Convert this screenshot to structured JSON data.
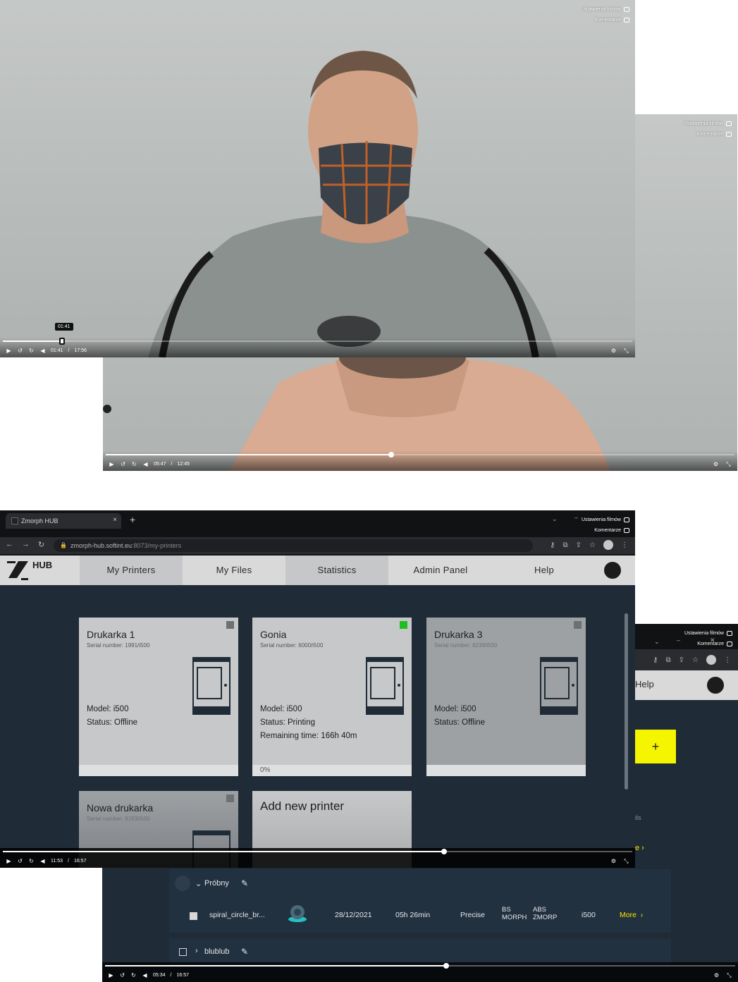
{
  "video1": {
    "overlay": {
      "settings": "Ustawienia filmów",
      "comments": "Komentarze"
    },
    "time_current": "01:41",
    "time_total": "17:56",
    "tooltip": "01:41",
    "progress_fraction": 0.094
  },
  "video2": {
    "overlay": {
      "settings": "Ustawienia filmów",
      "comments": "Komentarze"
    },
    "time_current": "05:47",
    "time_total": "12:45",
    "progress_fraction": 0.454
  },
  "video3": {
    "overlay": {
      "settings": "Ustawienia filmów",
      "comments": "Komentarze"
    },
    "time_current": "11:53",
    "time_total": "16:57",
    "progress_fraction": 0.701,
    "browser": {
      "tab_title": "Zmorph HUB",
      "url_host": "zmorph-hub.softint.eu",
      "url_path": ":8073/my-printers"
    },
    "nav": {
      "brand": "HUB",
      "tabs": [
        "My Printers",
        "My Files",
        "Statistics",
        "Admin Panel",
        "Help"
      ]
    },
    "printers": [
      {
        "name": "Drukarka 1",
        "serial": "Serial number: 1991/i500",
        "model_label": "Model:",
        "model": "i500",
        "status_label": "Status:",
        "status": "Offline",
        "online": false
      },
      {
        "name": "Gonia",
        "serial": "Serial number: 6000/i500",
        "model_label": "Model:",
        "model": "i500",
        "status_label": "Status:",
        "status": "Printing",
        "remaining_label": "Remaining time:",
        "remaining": "166h 40m",
        "progress": "0%",
        "online": true
      },
      {
        "name": "Drukarka 3",
        "serial": "Serial number: 8239/i500",
        "model_label": "Model:",
        "model": "i500",
        "status_label": "Status:",
        "status": "Offline",
        "online": false
      },
      {
        "name": "Nowa drukarka",
        "serial": "Serial number: 9193/i500",
        "online": false
      }
    ],
    "add_printer": "Add new printer"
  },
  "video4": {
    "overlay": {
      "settings": "Ustawienia filmów",
      "comments": "Komentarze"
    },
    "time_current": "05:34",
    "time_total": "16:57",
    "progress_fraction": 0.541,
    "help_label": "Help",
    "plus_label": "+",
    "side_text_1": "ils",
    "side_text_2": "e",
    "folder_1": {
      "name": "Próbny"
    },
    "file_row": {
      "name": "spiral_circle_br...",
      "date": "28/12/2021",
      "duration": "05h 26min",
      "quality": "Precise",
      "mat1_top": "BS",
      "mat1_bottom": "MORPH",
      "mat2_top": "ABS",
      "mat2_bottom": "ZMORP",
      "model": "i500",
      "more": "More"
    },
    "folder_2": {
      "name": "blublub"
    }
  }
}
